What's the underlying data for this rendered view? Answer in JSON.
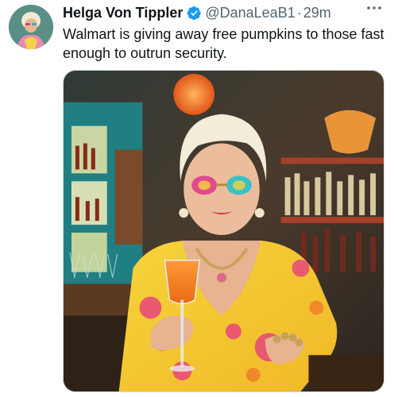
{
  "tweet": {
    "author_name": "Helga Von Tippler",
    "handle": "@DanaLeaB1",
    "separator": "·",
    "timestamp": "29m",
    "more_icon": "ellipsis-icon",
    "verified_icon": "verified-badge-icon",
    "text": "Walmart is giving away free pumpkins to those fast enough to outrun security."
  },
  "colors": {
    "verified": "#1d9bf0",
    "text_primary": "#0f1419",
    "text_secondary": "#536471"
  }
}
